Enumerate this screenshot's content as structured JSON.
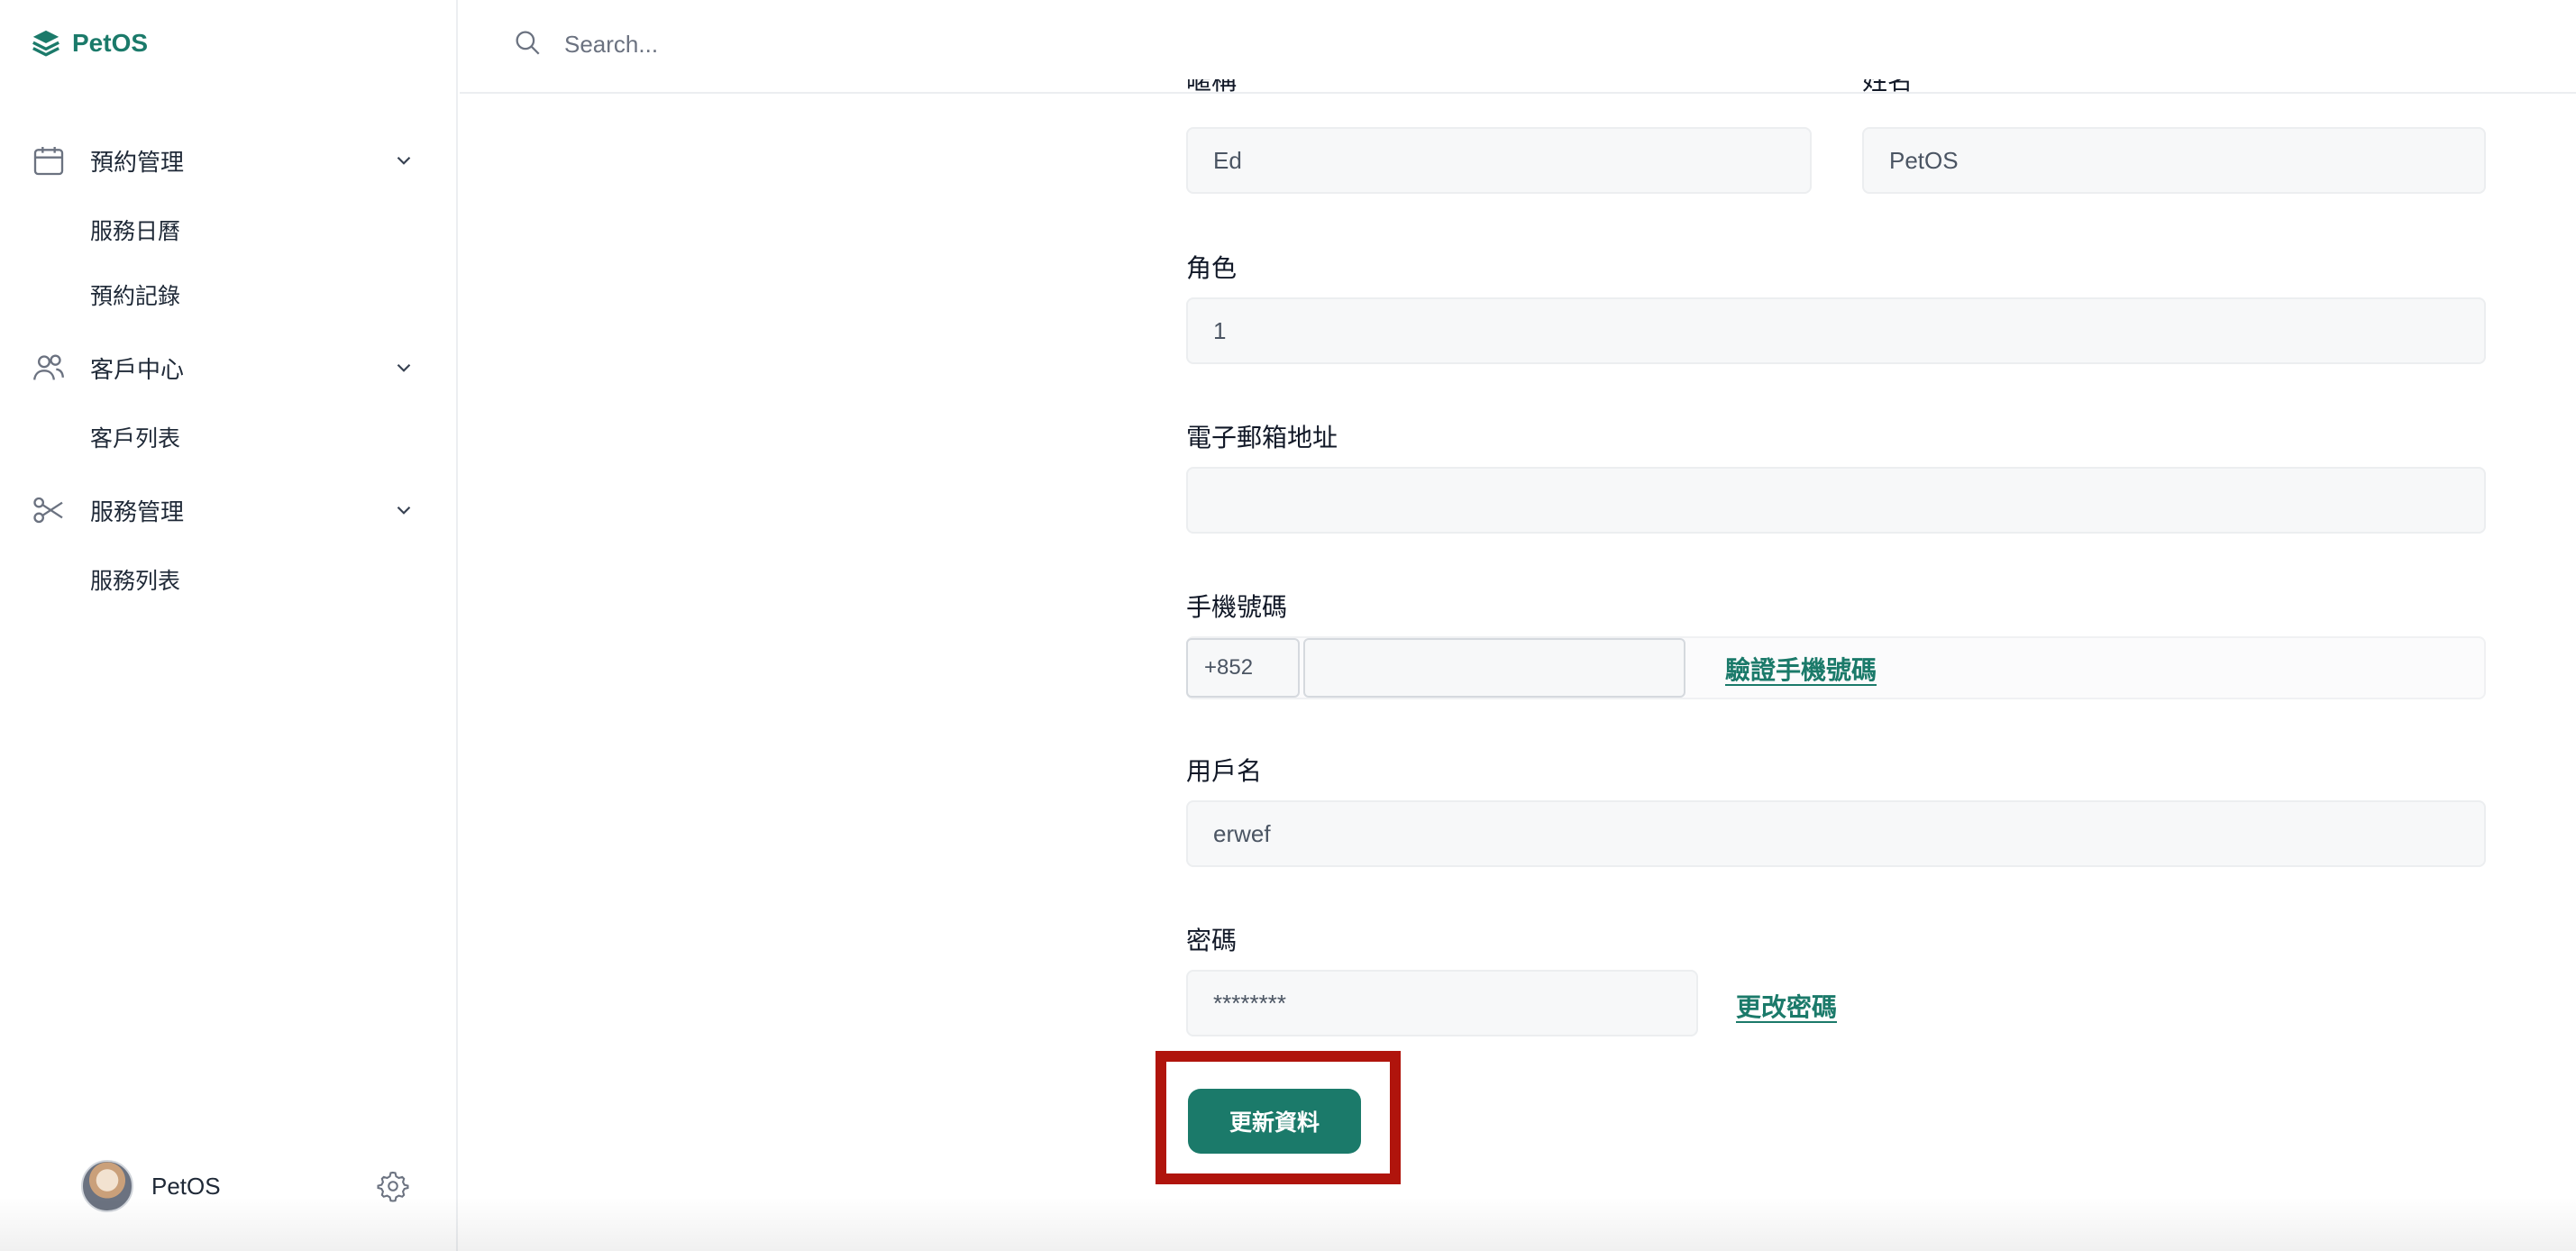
{
  "app": {
    "name": "PetOS"
  },
  "sidebar": {
    "groups": [
      {
        "label": "預約管理",
        "icon": "calendar-icon",
        "items": [
          "服務日曆",
          "預約記錄"
        ]
      },
      {
        "label": "客戶中心",
        "icon": "users-icon",
        "items": [
          "客戶列表"
        ]
      },
      {
        "label": "服務管理",
        "icon": "scissors-icon",
        "items": [
          "服務列表"
        ]
      }
    ],
    "user": {
      "name": "PetOS"
    }
  },
  "header": {
    "search_placeholder": "Search..."
  },
  "form": {
    "nickname": {
      "label": "暱稱",
      "value": "Ed"
    },
    "name": {
      "label": "姓名",
      "value": "PetOS"
    },
    "role": {
      "label": "角色",
      "value": "1"
    },
    "email": {
      "label": "電子郵箱地址",
      "value": ""
    },
    "phone": {
      "label": "手機號碼",
      "country_code": "+852",
      "value": "",
      "verify_link": "驗證手機號碼"
    },
    "username": {
      "label": "用戶名",
      "value": "erwef"
    },
    "password": {
      "label": "密碼",
      "value": "********",
      "change_link": "更改密碼"
    },
    "submit_label": "更新資料"
  },
  "colors": {
    "brand": "#1b7a6a",
    "highlight": "#b0140c"
  }
}
